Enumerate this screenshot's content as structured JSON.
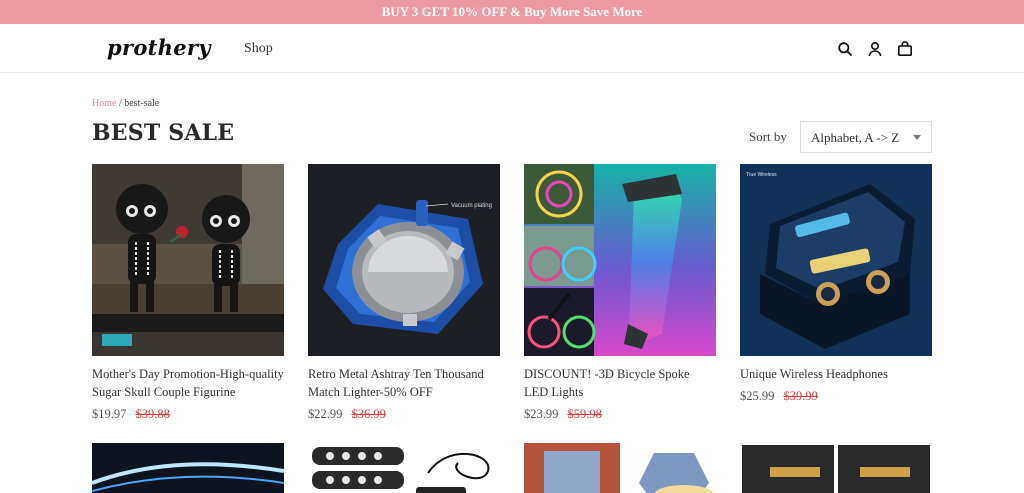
{
  "announcement": "BUY 3 GET 10% OFF & Buy More Save More",
  "header": {
    "logo": "prothery",
    "nav": [
      "Shop"
    ],
    "icons": [
      "search-icon",
      "account-icon",
      "cart-icon"
    ]
  },
  "breadcrumb": {
    "home": "Home",
    "separator": "/",
    "current": "best-sale"
  },
  "page_title": "BEST SALE",
  "sort": {
    "label": "Sort by",
    "value": "Alphabet, A -> Z"
  },
  "products": [
    {
      "name": "Mother's Day Promotion-High-quality Sugar Skull Couple Figurine",
      "price": "$19.97",
      "compare_at": "$39.88"
    },
    {
      "name": "Retro Metal Ashtray Ten Thousand Match Lighter-50% OFF",
      "price": "$22.99",
      "compare_at": "$36.99",
      "image_text": "Vacuum plating"
    },
    {
      "name": "DISCOUNT! -3D Bicycle Spoke LED Lights",
      "price": "$23.99",
      "compare_at": "$59.98"
    },
    {
      "name": "Unique Wireless Headphones",
      "price": "$25.99",
      "compare_at": "$39.99"
    }
  ],
  "colors": {
    "announcement_bg": "#ec9aa3",
    "breadcrumb_link": "#ec8a97",
    "sale_price": "#e23b3b"
  }
}
